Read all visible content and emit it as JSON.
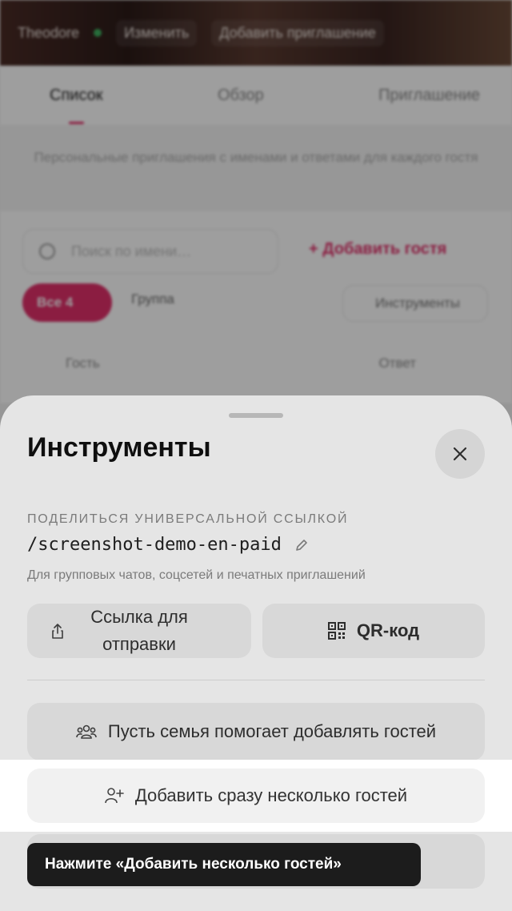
{
  "background": {
    "header": {
      "name": "Theodore",
      "edit_label": "Изменить",
      "add_invite_label": "Добавить приглашение"
    },
    "tabs": [
      {
        "label": "Список"
      },
      {
        "label": "Обзор"
      },
      {
        "label": "Приглашение"
      }
    ],
    "info_text": "Персональные приглашения с именами и ответами для каждого гостя",
    "search": {
      "placeholder": "Поиск по имени…"
    },
    "add_guest_label": "Добавить гостя",
    "filter_all": "Все 4",
    "filter_group": "Группа",
    "tools_label": "Инструменты",
    "columns": [
      "Гость",
      "Ответ"
    ],
    "accent_color": "#e0306a"
  },
  "sheet": {
    "title": "Инструменты",
    "share_label": "ПОДЕЛИТЬСЯ УНИВЕРСАЛЬНОЙ ССЫЛКОЙ",
    "share_link": "/screenshot-demo-en-paid",
    "share_desc": "Для групповых чатов, соцсетей и печатных приглашений",
    "send_link_label": "Ссылка для отправки",
    "qr_label": "QR-код",
    "family_label": "Пусть семья помогает добавлять гостей",
    "bulk_add_label": "Добавить сразу несколько гостей"
  },
  "tooltip": "Нажмите «Добавить несколько гостей»"
}
